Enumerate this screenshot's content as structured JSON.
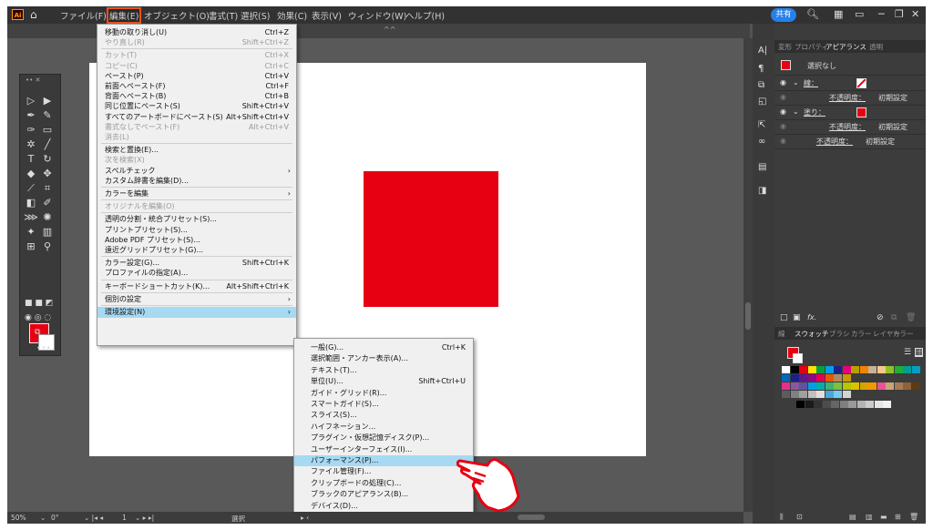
{
  "app": {
    "logo": "Ai",
    "home": "⌂"
  },
  "menubar": {
    "items": [
      "ファイル(F)",
      "編集(E)",
      "オブジェクト(O)",
      "書式(T)",
      "選択(S)",
      "効果(C)",
      "表示(V)",
      "ウィンドウ(W)",
      "ヘルプ(H)"
    ],
    "active_index": 1,
    "share_label": "共有"
  },
  "edit_menu": [
    {
      "label": "移動の取り消し(U)",
      "shortcut": "Ctrl+Z"
    },
    {
      "label": "やり直し(R)",
      "shortcut": "Shift+Ctrl+Z",
      "disabled": true
    },
    {
      "sep": true
    },
    {
      "label": "カット(T)",
      "shortcut": "Ctrl+X",
      "disabled": true
    },
    {
      "label": "コピー(C)",
      "shortcut": "Ctrl+C",
      "disabled": true
    },
    {
      "label": "ペースト(P)",
      "shortcut": "Ctrl+V"
    },
    {
      "label": "前面へペースト(F)",
      "shortcut": "Ctrl+F"
    },
    {
      "label": "背面へペースト(B)",
      "shortcut": "Ctrl+B"
    },
    {
      "label": "同じ位置にペースト(S)",
      "shortcut": "Shift+Ctrl+V"
    },
    {
      "label": "すべてのアートボードにペースト(S)",
      "shortcut": "Alt+Shift+Ctrl+V"
    },
    {
      "label": "書式なしでペースト(F)",
      "shortcut": "Alt+Ctrl+V",
      "disabled": true
    },
    {
      "label": "消去(L)",
      "disabled": true
    },
    {
      "sep": true
    },
    {
      "label": "検索と置換(E)..."
    },
    {
      "label": "次を検索(X)",
      "disabled": true
    },
    {
      "label": "スペルチェック",
      "arrow": true
    },
    {
      "label": "カスタム辞書を編集(D)..."
    },
    {
      "sep": true
    },
    {
      "label": "カラーを編集",
      "arrow": true
    },
    {
      "sep": true
    },
    {
      "label": "オリジナルを編集(O)",
      "disabled": true
    },
    {
      "sep": true
    },
    {
      "label": "透明の分割・統合プリセット(S)..."
    },
    {
      "label": "プリントプリセット(S)..."
    },
    {
      "label": "Adobe PDF プリセット(S)..."
    },
    {
      "label": "遠近グリッドプリセット(G)..."
    },
    {
      "sep": true
    },
    {
      "label": "カラー設定(G)...",
      "shortcut": "Shift+Ctrl+K"
    },
    {
      "label": "プロファイルの指定(A)..."
    },
    {
      "sep": true
    },
    {
      "label": "キーボードショートカット(K)...",
      "shortcut": "Alt+Shift+Ctrl+K"
    },
    {
      "sep": true
    },
    {
      "label": "個別の設定",
      "arrow": true
    },
    {
      "sep": true
    },
    {
      "label": "環境設定(N)",
      "arrow": true,
      "highlight": true
    }
  ],
  "prefs_submenu": [
    {
      "label": "一般(G)...",
      "shortcut": "Ctrl+K"
    },
    {
      "label": "選択範囲・アンカー表示(A)..."
    },
    {
      "label": "テキスト(T)..."
    },
    {
      "label": "単位(U)...",
      "shortcut": "Shift+Ctrl+U"
    },
    {
      "label": "ガイド・グリッド(R)..."
    },
    {
      "label": "スマートガイド(S)..."
    },
    {
      "label": "スライス(S)..."
    },
    {
      "label": "ハイフネーション..."
    },
    {
      "label": "プラグイン・仮想記憶ディスク(P)..."
    },
    {
      "label": "ユーザーインターフェイス(I)..."
    },
    {
      "label": "パフォーマンス(P)...",
      "highlight": true
    },
    {
      "label": "ファイル管理(F)..."
    },
    {
      "label": "クリップボードの処理(C)..."
    },
    {
      "label": "ブラックのアピアランス(B)..."
    },
    {
      "label": "デバイス(D)..."
    }
  ],
  "panel": {
    "top_tabs": [
      "変形",
      "プロパティ",
      "アピアランス",
      "透明"
    ],
    "active_top_tab": 2,
    "selection": "選択なし",
    "stroke_label": "線：",
    "fill_label": "塗り：",
    "opacity_label": "不透明度：",
    "opacity_value": "初期設定",
    "fx": "fx.",
    "bottom_tabs": [
      "線",
      "スウォッチ",
      "ブラシ",
      "カラー",
      "レイヤー",
      "カラー"
    ],
    "active_bottom_tab": 1
  },
  "status": {
    "zoom": "50%",
    "angle": "0°",
    "artboard": "1",
    "mode": "選択"
  },
  "colors": {
    "accent": "#e8541e",
    "red": "#e60012",
    "highlight": "#a6d9f2",
    "share": "#2680eb"
  },
  "swatches": {
    "row1": [
      "#ffffff",
      "#000000",
      "#e60012",
      "#ffe100",
      "#00a23e",
      "#00a0e9",
      "#1d2088",
      "#e4007f",
      "#b8a000",
      "#f08300",
      "#c7b299",
      "#f5c78d",
      "#8fc31f",
      "#22ac38",
      "#009e96",
      "#00a0c1",
      "#0068b7",
      "#1d2088",
      "#601986",
      "#920783",
      "#e5004f",
      "#ea5504",
      "#ae8b5f",
      "#cc9900"
    ],
    "row2": [
      "#e62f8b",
      "#8957a1",
      "#5f52a0",
      "#00a0e9",
      "#00ada9",
      "#3eb370",
      "#7ec03f",
      "#b4c800",
      "#d9c200",
      "#d8a300",
      "#f39800",
      "#e85298",
      "#c8a678",
      "#a67c52",
      "#8c6239",
      "#603813",
      "#5c5c5c",
      "#808080",
      "#a0a0a0",
      "#c0c0c0",
      "#e0e0e0",
      "#4aa6d9",
      "#77cbf0",
      "#d4d4d4"
    ],
    "gray": [
      "#000000",
      "#1a1a1a",
      "#333333",
      "#4d4d4d",
      "#666666",
      "#808080",
      "#999999",
      "#b3b3b3",
      "#cccccc",
      "#e6e6e6",
      "#f2f2f2"
    ]
  }
}
